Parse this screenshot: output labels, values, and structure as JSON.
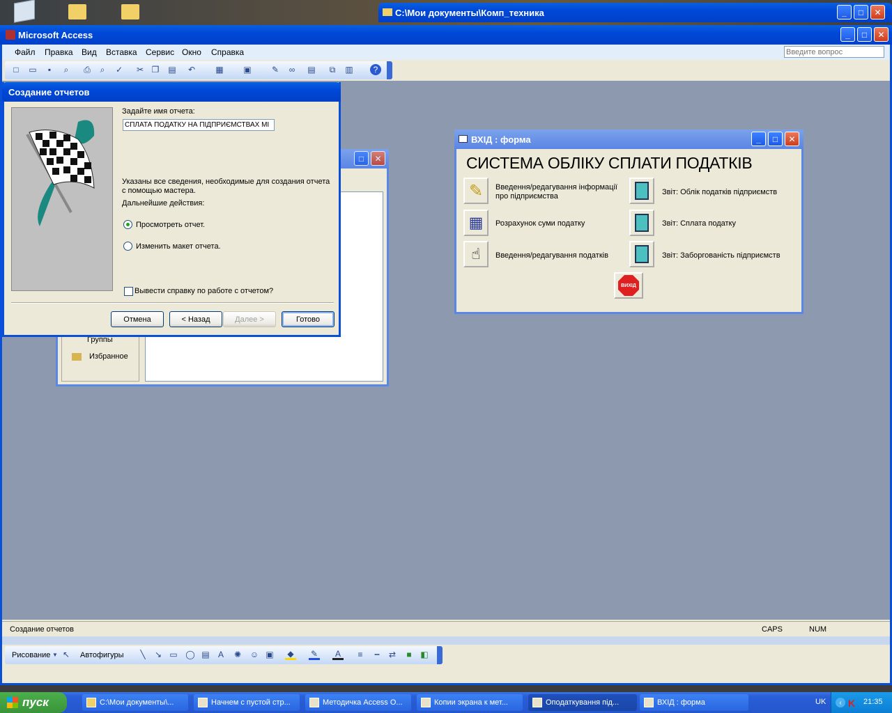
{
  "desktop": {
    "explorer_title": "C:\\Мои документы\\Комп_техника"
  },
  "app": {
    "title": "Microsoft Access",
    "menu": [
      "Файл",
      "Правка",
      "Вид",
      "Вставка",
      "Сервис",
      "Окно",
      "Справка"
    ],
    "help_placeholder": "Введите вопрос",
    "status_text": "Создание отчетов",
    "status_caps": "CAPS",
    "status_num": "NUM"
  },
  "wizard": {
    "title": "Создание отчетов",
    "name_label": "Задайте имя отчета:",
    "name_value": "СПЛАТА ПОДАТКУ НА ПІДПРИЄМСТВАХ МІ",
    "info_text": "Указаны все сведения, необходимые для создания отчета с помощью мастера.",
    "next_label": "Дальнейшие действия:",
    "option_preview": "Просмотреть отчет.",
    "option_modify": "Изменить макет отчета.",
    "help_checkbox": "Вывести справку по работе с отчетом?",
    "btn_cancel": "Отмена",
    "btn_back": "< Назад",
    "btn_next": "Далее >",
    "btn_finish": "Готово"
  },
  "dbwindow": {
    "groups_label": "Группы",
    "favorites_label": "Избранное"
  },
  "form": {
    "title": "ВХІД : форма",
    "heading": "СИСТЕМА ОБЛІКУ СПЛАТИ ПОДАТКІВ",
    "left_buttons": [
      "Введення/редагування інформації про підприємства",
      "Розрахунок суми податку",
      "Введення/редагування податків"
    ],
    "right_buttons": [
      "Звіт: Облік податків підприємств",
      "Звіт: Сплата податку",
      "Звіт: Заборгованість підприємств"
    ],
    "exit_label": "ВИХІД"
  },
  "drawing_toolbar": {
    "draw_label": "Рисование",
    "autoshapes_label": "Автофигуры"
  },
  "taskbar": {
    "start_label": "пуск",
    "tasks": [
      "C:\\Мои документы\\...",
      "Начнем с пустой стр...",
      "Методичка Access О...",
      "Копии экрана к мет...",
      "Оподаткування під...",
      "ВХІД : форма"
    ],
    "lang": "UK",
    "time": "21:35"
  },
  "colors": {
    "mdi_background": "#8d99ae",
    "xp_blue": "#0a5fe0",
    "panel": "#ece9d8",
    "taskbar": "#2a5fd8",
    "start": "#3c9a3c"
  }
}
